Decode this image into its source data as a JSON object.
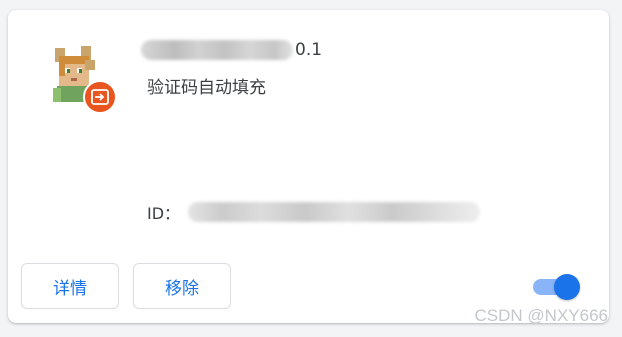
{
  "extension": {
    "version": "0.1",
    "description": "验证码自动填充",
    "id_label": "ID："
  },
  "buttons": {
    "details_label": "详情",
    "remove_label": "移除"
  },
  "toggle": {
    "enabled": true
  },
  "watermark": "CSDN @NXY666",
  "colors": {
    "accent": "#1a73e8",
    "badge": "#e8551f"
  }
}
